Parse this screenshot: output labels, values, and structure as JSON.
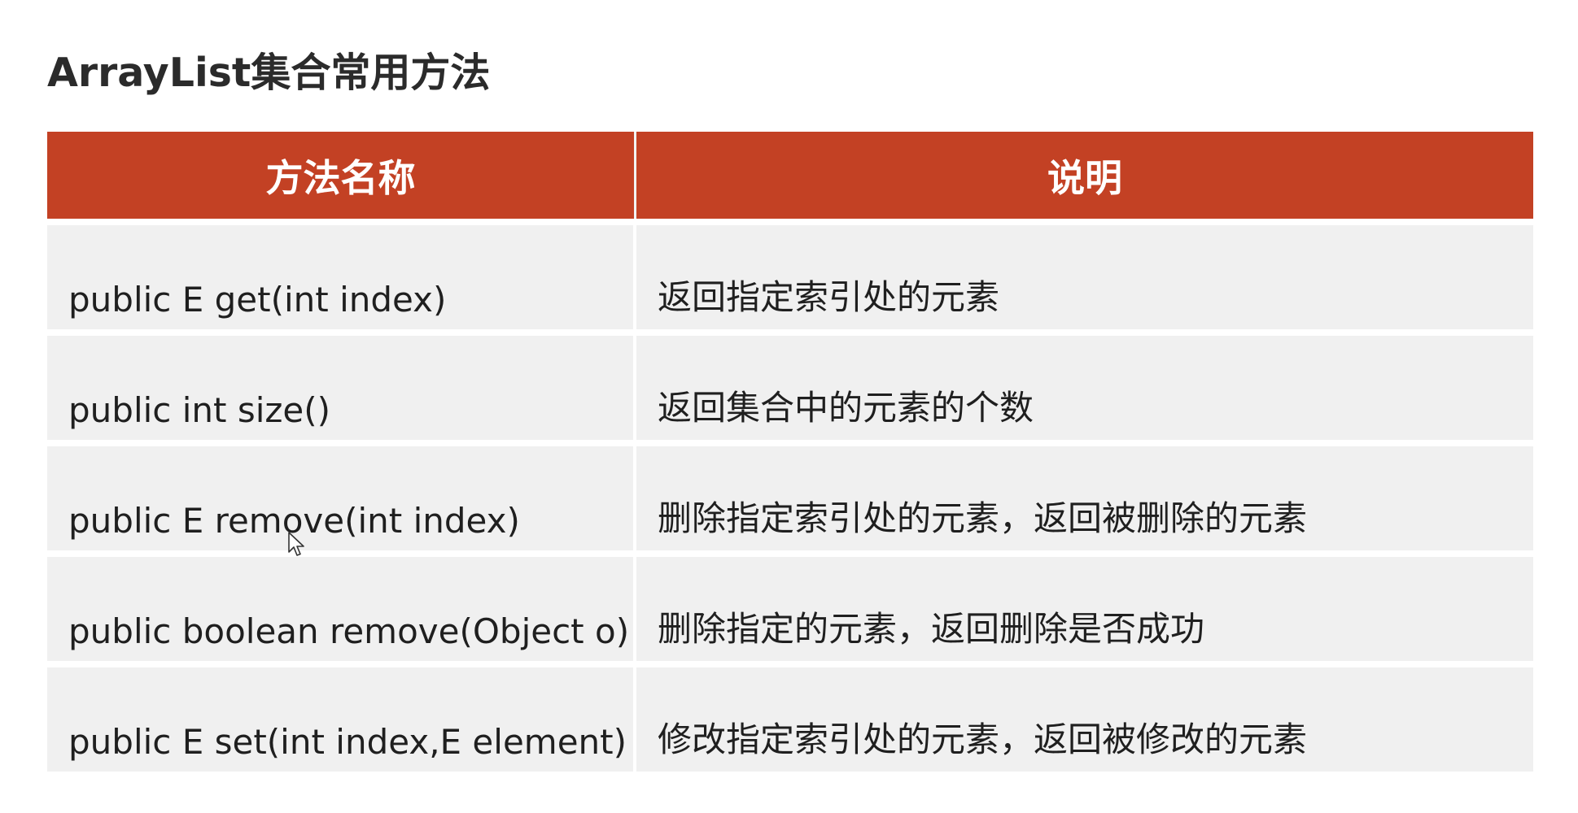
{
  "title": "ArrayList集合常用方法",
  "table": {
    "headers": {
      "name": "方法名称",
      "desc": "说明"
    },
    "rows": [
      {
        "name": "public E get(int index)",
        "desc": "返回指定索引处的元素"
      },
      {
        "name": "public int size()",
        "desc": "返回集合中的元素的个数"
      },
      {
        "name": "public E remove(int index)",
        "desc": "删除指定索引处的元素，返回被删除的元素"
      },
      {
        "name": "public boolean remove(Object o)",
        "desc": "删除指定的元素，返回删除是否成功"
      },
      {
        "name": "public E set(int index,E element)",
        "desc": "修改指定索引处的元素，返回被修改的元素"
      }
    ]
  },
  "colors": {
    "header_bg": "#c34124",
    "row_bg": "#f0f0f0"
  },
  "icons": {
    "cursor": "mouse-pointer-icon"
  }
}
